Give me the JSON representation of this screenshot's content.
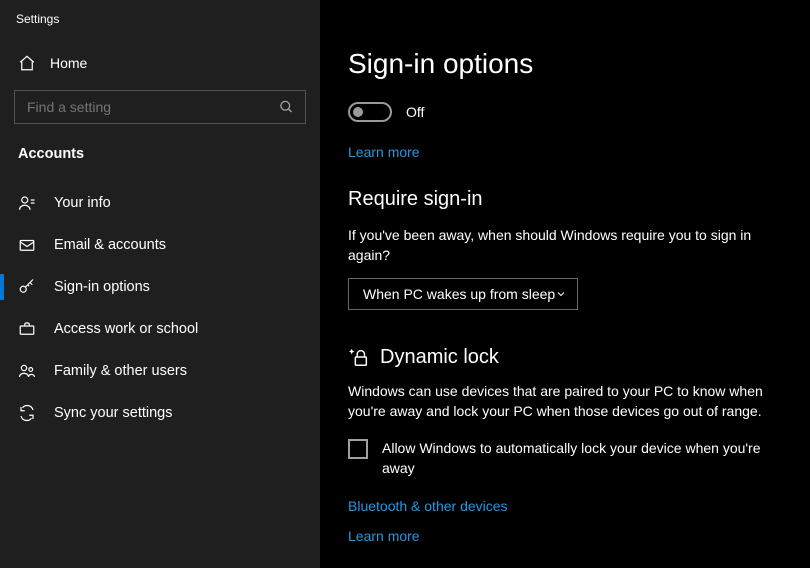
{
  "window": {
    "title": "Settings"
  },
  "sidebar": {
    "home": "Home",
    "search_placeholder": "Find a setting",
    "section": "Accounts",
    "items": [
      {
        "label": "Your info"
      },
      {
        "label": "Email & accounts"
      },
      {
        "label": "Sign-in options"
      },
      {
        "label": "Access work or school"
      },
      {
        "label": "Family & other users"
      },
      {
        "label": "Sync your settings"
      }
    ],
    "active_index": 2
  },
  "main": {
    "title": "Sign-in options",
    "toggle_state": "Off",
    "learn_more": "Learn more",
    "require": {
      "heading": "Require sign-in",
      "desc": "If you've been away, when should Windows require you to sign in again?",
      "selected": "When PC wakes up from sleep"
    },
    "dynamic": {
      "heading": "Dynamic lock",
      "desc": "Windows can use devices that are paired to your PC to know when you're away and lock your PC when those devices go out of range.",
      "checkbox_label": "Allow Windows to automatically lock your device when you're away",
      "bluetooth_link": "Bluetooth & other devices",
      "learn_more": "Learn more"
    }
  }
}
